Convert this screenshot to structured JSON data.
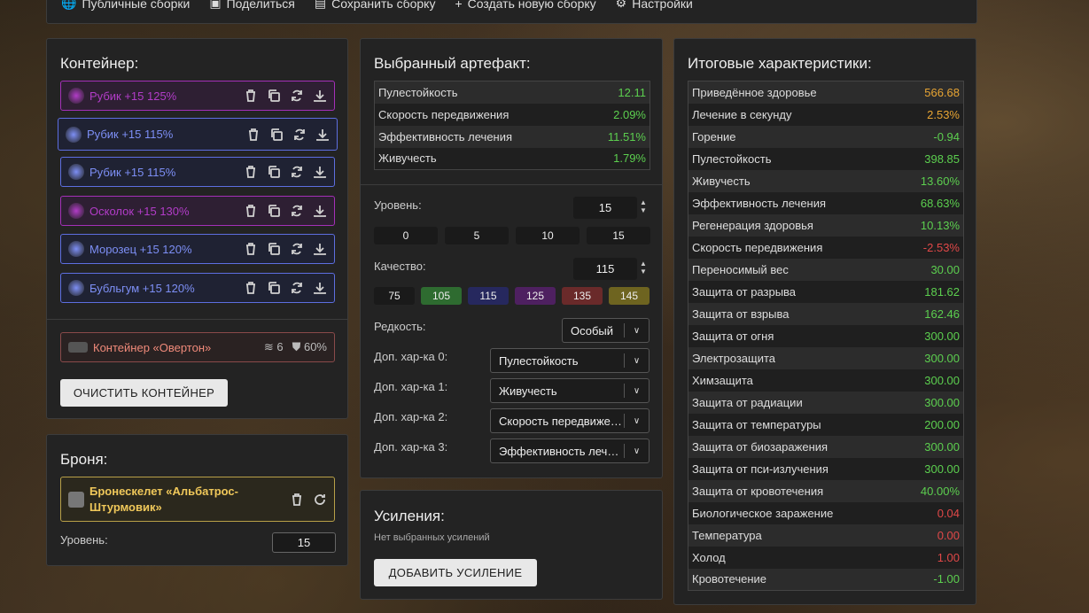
{
  "topbar": {
    "items": [
      {
        "label": "Публичные сборки",
        "icon": "globe-icon"
      },
      {
        "label": "Поделиться",
        "icon": "image-icon"
      },
      {
        "label": "Сохранить сборку",
        "icon": "save-icon"
      },
      {
        "label": "Создать новую сборку",
        "icon": "plus-icon"
      },
      {
        "label": "Настройки",
        "icon": "gear-icon"
      }
    ]
  },
  "container": {
    "title": "Контейнер:",
    "artifacts": [
      {
        "label": "Рубик +15 125%",
        "color": "#b23cc8",
        "border": "#a430b8",
        "bg": "#2e1f33",
        "selected": false
      },
      {
        "label": "Рубик +15 115%",
        "color": "#7d8ff5",
        "border": "#5d6ee0",
        "bg": "#1f2233",
        "selected": true
      },
      {
        "label": "Рубик +15 115%",
        "color": "#7d8ff5",
        "border": "#5d6ee0",
        "bg": "#1f2233",
        "selected": false
      },
      {
        "label": "Осколок +15 130%",
        "color": "#b23cc8",
        "border": "#a430b8",
        "bg": "#2e1f33",
        "selected": false
      },
      {
        "label": "Морозец +15 120%",
        "color": "#7d8ff5",
        "border": "#5d6ee0",
        "bg": "#1f2233",
        "selected": false
      },
      {
        "label": "Бубльгум +15 120%",
        "color": "#7d8ff5",
        "border": "#5d6ee0",
        "bg": "#1f2233",
        "selected": false
      }
    ],
    "box": {
      "label": "Контейнер «Овертон»",
      "slots": "6",
      "protection": "60%"
    },
    "clear_label": "ОЧИСТИТЬ КОНТЕЙНЕР"
  },
  "armor": {
    "title": "Броня:",
    "name": "Бронескелет «Альбатрос-Штурмовик»",
    "level_label": "Уровень:",
    "level": "15"
  },
  "artifact": {
    "title": "Выбранный артефакт:",
    "stats": [
      {
        "name": "Пулестойкость",
        "value": "12.11"
      },
      {
        "name": "Скорость передвижения",
        "value": "2.09%"
      },
      {
        "name": "Эффективность лечения",
        "value": "11.51%"
      },
      {
        "name": "Живучесть",
        "value": "1.79%"
      }
    ],
    "level_label": "Уровень:",
    "level": "15",
    "level_presets": [
      "0",
      "5",
      "10",
      "15"
    ],
    "quality_label": "Качество:",
    "quality": "115",
    "quality_presets": [
      {
        "label": "75",
        "color": "#1a1a1a"
      },
      {
        "label": "105",
        "color": "#2e6b30"
      },
      {
        "label": "115",
        "color": "#26285e"
      },
      {
        "label": "125",
        "color": "#4e2060"
      },
      {
        "label": "135",
        "color": "#6a2a2a"
      },
      {
        "label": "145",
        "color": "#6e6420"
      }
    ],
    "rarity_label": "Редкость:",
    "rarity": "Особый",
    "extras": [
      {
        "label": "Доп. хар-ка 0:",
        "value": "Пулестойкость"
      },
      {
        "label": "Доп. хар-ка 1:",
        "value": "Живучесть"
      },
      {
        "label": "Доп. хар-ка 2:",
        "value": "Скорость передвижения"
      },
      {
        "label": "Доп. хар-ка 3:",
        "value": "Эффективность лечения"
      }
    ]
  },
  "boosts": {
    "title": "Усиления:",
    "empty": "Нет выбранных усилений",
    "add_label": "ДОБАВИТЬ УСИЛЕНИЕ"
  },
  "totals": {
    "title": "Итоговые характеристики:",
    "rows": [
      {
        "name": "Приведённое здоровье",
        "value": "566.68",
        "tone": "o"
      },
      {
        "name": "Лечение в секунду",
        "value": "2.53%",
        "tone": "o"
      },
      {
        "name": "Горение",
        "value": "-0.94",
        "tone": "g"
      },
      {
        "name": "Пулестойкость",
        "value": "398.85",
        "tone": "g"
      },
      {
        "name": "Живучесть",
        "value": "13.60%",
        "tone": "g"
      },
      {
        "name": "Эффективность лечения",
        "value": "68.63%",
        "tone": "g"
      },
      {
        "name": "Регенерация здоровья",
        "value": "10.13%",
        "tone": "g"
      },
      {
        "name": "Скорость передвижения",
        "value": "-2.53%",
        "tone": "r"
      },
      {
        "name": "Переносимый вес",
        "value": "30.00",
        "tone": "g"
      },
      {
        "name": "Защита от разрыва",
        "value": "181.62",
        "tone": "g"
      },
      {
        "name": "Защита от взрыва",
        "value": "162.46",
        "tone": "g"
      },
      {
        "name": "Защита от огня",
        "value": "300.00",
        "tone": "g"
      },
      {
        "name": "Электрозащита",
        "value": "300.00",
        "tone": "g"
      },
      {
        "name": "Химзащита",
        "value": "300.00",
        "tone": "g"
      },
      {
        "name": "Защита от радиации",
        "value": "300.00",
        "tone": "g"
      },
      {
        "name": "Защита от температуры",
        "value": "200.00",
        "tone": "g"
      },
      {
        "name": "Защита от биозаражения",
        "value": "300.00",
        "tone": "g"
      },
      {
        "name": "Защита от пси-излучения",
        "value": "300.00",
        "tone": "g"
      },
      {
        "name": "Защита от кровотечения",
        "value": "40.00%",
        "tone": "g"
      },
      {
        "name": "Биологическое заражение",
        "value": "0.04",
        "tone": "r"
      },
      {
        "name": "Температура",
        "value": "0.00",
        "tone": "r"
      },
      {
        "name": "Холод",
        "value": "1.00",
        "tone": "r"
      },
      {
        "name": "Кровотечение",
        "value": "-1.00",
        "tone": "g"
      }
    ]
  }
}
